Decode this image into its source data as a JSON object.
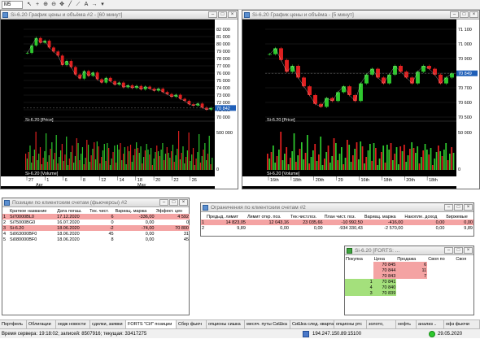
{
  "toolbar": {
    "interval_value": "M5",
    "icons": [
      "pointer-icon",
      "crosshair-icon",
      "zoom-in-icon",
      "zoom-out-icon",
      "move-icon",
      "line-icon",
      "trendline-icon",
      "text-icon",
      "arrow-icon",
      "more-icon"
    ]
  },
  "chart1": {
    "title": "Si-6.20 График цены и объёма #2 - [60 минут]",
    "price_ticks": [
      "82 000",
      "81 000",
      "80 000",
      "79 000",
      "78 000",
      "77 000",
      "76 000",
      "75 000",
      "74 000",
      "73 000",
      "72 000",
      "71 000",
      "70 000"
    ],
    "last_price": "70 842",
    "price_series_label": "Si-6.20 [Price]",
    "volume_series_label": "Si-6.20 [Volume]",
    "volume_ticks": [
      "500 000",
      "0"
    ],
    "date_labels": [
      "27",
      "1",
      "6",
      "8",
      "12",
      "14",
      "18",
      "20",
      "22",
      "26"
    ],
    "month_labels": [
      "Apr",
      "May"
    ],
    "chart_data": {
      "type": "line",
      "series": [
        {
          "name": "Si-6.20 [Price]",
          "values": [
            79000,
            80100,
            81200,
            80500,
            80800,
            79800,
            79200,
            78600,
            77200,
            77800,
            76900,
            75800,
            75200,
            76300,
            75600,
            76100,
            75100,
            74600,
            75300,
            74800,
            74300,
            74600,
            73900,
            74200,
            73800,
            74100,
            73600,
            74000,
            73700,
            73400,
            73700,
            73200,
            72900,
            72500,
            72800,
            72200,
            71900,
            71400,
            71200,
            71500,
            70900,
            70600,
            70842
          ]
        }
      ],
      "ylim": [
        69500,
        82500
      ]
    }
  },
  "chart2": {
    "title": "Si-6.20 График цены и объёма - [5 минут]",
    "price_ticks": [
      "71 100",
      "71 000",
      "70 900",
      "70 800",
      "70 700",
      "70 600",
      "70 500"
    ],
    "last_price": "70 849",
    "price_series_label": "Si-6.20 [Price]",
    "volume_series_label": "Si-6.20 [Volume]",
    "volume_ticks": [
      "50 000",
      "0"
    ],
    "date_labels": [
      "16th",
      "18th",
      "20th",
      "29",
      "16th",
      "18th",
      "20th",
      "18th"
    ],
    "chart_data": {
      "type": "line",
      "series": [
        {
          "name": "Si-6.20 [Price]",
          "values": [
            70980,
            71020,
            70940,
            70860,
            70900,
            70820,
            70760,
            70700,
            70640,
            70620,
            70680,
            70660,
            70720,
            70760,
            70700,
            70660,
            70780,
            70840,
            70880,
            70820,
            70780,
            70840,
            70900,
            70860,
            70820,
            70780,
            70860,
            70900,
            70880,
            70840,
            70780,
            70820,
            70849
          ]
        }
      ],
      "ylim": [
        70550,
        71150
      ]
    }
  },
  "positions": {
    "title": "Позиции по клиентским счетам (фьючерсы) #2",
    "columns": [
      "Краткое название",
      "Дата погаш.",
      "Тек. чист.",
      "Вариац. маржа",
      "Эффект. цен"
    ],
    "rows": [
      [
        "1",
        "Si70000BL0",
        "17.12.2020",
        "6",
        "-336,00",
        "4 592"
      ],
      [
        "2",
        "Si75000BG0",
        "16.07.2020",
        "0",
        "0,00",
        "0"
      ],
      [
        "3",
        "Si-6.20",
        "18.06.2020",
        "-2",
        "-74,00",
        "70 800"
      ],
      [
        "4",
        "Si063000BF0",
        "18.06.2020",
        "45",
        "0,00",
        "31"
      ],
      [
        "5",
        "Si080000BF0",
        "18.06.2020",
        "8",
        "0,00",
        "45"
      ]
    ]
  },
  "limits": {
    "title": "Ограничения по клиентским счетам #2",
    "columns": [
      "Предыд. лимит",
      "Лимит откр. поз.",
      "Тек.чист.поз.",
      "План чист. поз.",
      "Вариац. маржа",
      "Накопле. доход",
      "Биржевые"
    ],
    "rows": [
      [
        "1",
        "14 823,05",
        "12 043,16",
        "23 035,66",
        "-10 992,50",
        "-416,00",
        "0,00",
        "0,00"
      ],
      [
        "2",
        "9,89",
        "0,00",
        "0,00",
        "-934 330,43",
        "-2 570,00",
        "0,00",
        "9,89"
      ]
    ]
  },
  "orderbook": {
    "title": "Si-6.20 [FORTS: ...",
    "columns": [
      "Покупка",
      "Цена",
      "Продажа",
      "Своя по",
      "Своя"
    ],
    "rows": [
      [
        "",
        "70 845",
        "6",
        "",
        ""
      ],
      [
        "",
        "70 844",
        "11",
        "",
        ""
      ],
      [
        "",
        "70 843",
        "7",
        "",
        ""
      ],
      [
        "1",
        "70 841",
        "",
        "",
        ""
      ],
      [
        "4",
        "70 840",
        "",
        "",
        ""
      ],
      [
        "3",
        "70 839",
        "",
        "",
        ""
      ]
    ]
  },
  "tabs": [
    "Портфель",
    "Облигации",
    "хедж новости",
    "сделки, заявки",
    "FORTS \"СИ\" позиции",
    "Сбер фьюч",
    "опционы сишка",
    "месяч. путы СиШка",
    "СиШка след. квартал",
    "опционы ртс",
    "золото,",
    "нефть",
    "анализ ..",
    "офз фьючи"
  ],
  "status": {
    "server_time": "Время сервера: 19:18:02; записей: 8507916; текущая: 33417275",
    "ip": "194.247.150.89:15100",
    "date": "29.05.2020"
  },
  "colors": {
    "up": "#2ec82e",
    "down": "#e02020",
    "price_line": "#f4f4f4",
    "highlight_red": "#f4a3a3",
    "highlight_green": "#a4e07c"
  }
}
